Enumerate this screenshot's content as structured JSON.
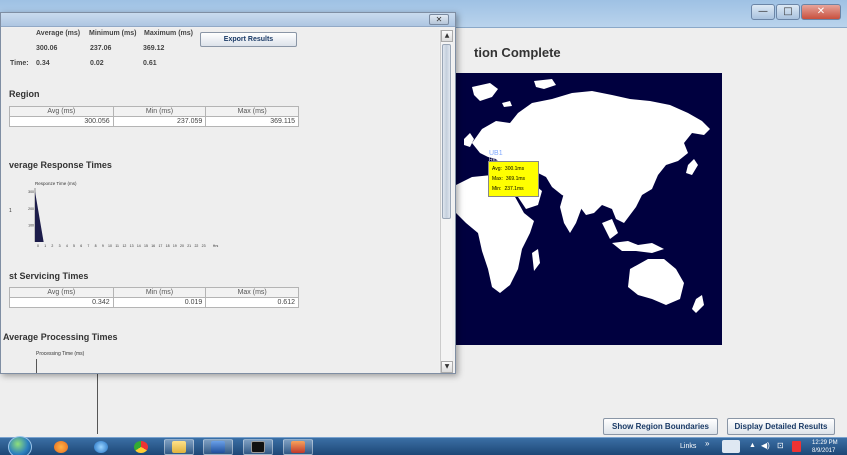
{
  "main_window": {
    "title_buttons": [
      "—",
      "□",
      "✕"
    ],
    "simulation_title": "tion Complete",
    "show_region_button": "Show Region Boundaries",
    "display_detailed_button": "Display Detailed Results"
  },
  "map": {
    "ub_label": "UB1",
    "resp_label": "Resp. time",
    "tooltip": [
      {
        "label": "Avg:",
        "value": "300.1ms"
      },
      {
        "label": "Max:",
        "value": "369.1ms"
      },
      {
        "label": "Min:",
        "value": "237.1ms"
      }
    ],
    "ocean_color": "#00003f",
    "land_color": "#ffffff",
    "tooltip_color": "#ffff00"
  },
  "dialog": {
    "title": "",
    "export_button": "Export Results",
    "summary": {
      "headers": [
        "Average (ms)",
        "Minimum (ms)",
        "Maximum (ms)"
      ],
      "row1": [
        "300.06",
        "237.06",
        "369.12"
      ],
      "row2_label": "Time:",
      "row2": [
        "0.34",
        "0.02",
        "0.61"
      ]
    },
    "region_title": "Region",
    "region_table": {
      "headers": [
        "Avg (ms)",
        "Min (ms)",
        "Max (ms)"
      ],
      "row": [
        "300.056",
        "237.059",
        "369.115"
      ]
    },
    "avg_response_title": "verage Response Times",
    "dc_title": "st Servicing Times",
    "dc_table": {
      "headers": [
        "Avg (ms)",
        "Min (ms)",
        "Max (ms)"
      ],
      "row": [
        "0.342",
        "0.019",
        "0.612"
      ]
    },
    "processing_title": " Average Processing Times",
    "processing_chart_label": "Processing Time (ms)"
  },
  "chart_data": {
    "type": "area",
    "title": "",
    "ylabel": "Responze Time (ms)",
    "xlabel": "Hrs",
    "side_label": "1",
    "x": [
      0,
      1
    ],
    "values": [
      300,
      0
    ],
    "y_ticks": [
      "300",
      "200",
      "100"
    ],
    "x_ticks": [
      "0",
      "1",
      "2",
      "3",
      "4",
      "5",
      "6",
      "7",
      "8",
      "9",
      "10",
      "11",
      "12",
      "13",
      "14",
      "15",
      "16",
      "17",
      "18",
      "19",
      "20",
      "21",
      "22",
      "23"
    ],
    "ylim": [
      0,
      320
    ],
    "fill_color": "#1c1c4a"
  },
  "taskbar": {
    "links_label": "Links",
    "time": "12:29 PM",
    "date": "8/9/2017"
  }
}
